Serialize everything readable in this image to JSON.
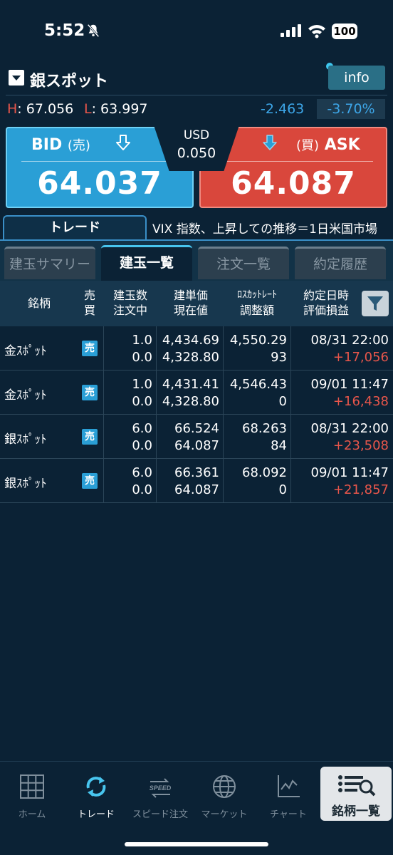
{
  "status": {
    "time": "5:52",
    "battery": "100"
  },
  "header": {
    "symbol": "銀スポット",
    "info_label": "info",
    "high_label": "H",
    "high": ": 67.056",
    "low_label": "L",
    "low": ": 63.997",
    "change": "-2.463",
    "change_pct": "-3.70%"
  },
  "quote": {
    "bid_label": "BID",
    "bid_sub": "(売)",
    "bid": "64.037",
    "ask_sub": "(買)",
    "ask_label": "ASK",
    "ask": "64.087",
    "currency": "USD",
    "spread": "0.050"
  },
  "trade_tab": "トレード",
  "ticker": "VIX 指数、上昇しての推移＝1日米国市場",
  "subtabs": [
    "建玉サマリー",
    "建玉一覧",
    "注文一覧",
    "約定履歴"
  ],
  "table_header": {
    "symbol": "銘柄",
    "side1": "売",
    "side2": "買",
    "qty1": "建玉数",
    "qty2": "注文中",
    "price1": "建単価",
    "price2": "現在値",
    "losscut1": "ﾛｽｶｯﾄﾚｰﾄ",
    "losscut2": "調整額",
    "date1": "約定日時",
    "date2": "評価損益"
  },
  "rows": [
    {
      "name": "金ｽﾎﾟｯﾄ",
      "side": "売",
      "qty": "1.0",
      "pending": "0.0",
      "entry": "4,434.69",
      "current": "4,328.80",
      "losscut": "4,550.29",
      "adjust": "93",
      "datetime": "08/31 22:00",
      "pl": "+17,056"
    },
    {
      "name": "金ｽﾎﾟｯﾄ",
      "side": "売",
      "qty": "1.0",
      "pending": "0.0",
      "entry": "4,431.41",
      "current": "4,328.80",
      "losscut": "4,546.43",
      "adjust": "0",
      "datetime": "09/01 11:47",
      "pl": "+16,438"
    },
    {
      "name": "銀ｽﾎﾟｯﾄ",
      "side": "売",
      "qty": "6.0",
      "pending": "0.0",
      "entry": "66.524",
      "current": "64.087",
      "losscut": "68.263",
      "adjust": "84",
      "datetime": "08/31 22:00",
      "pl": "+23,508"
    },
    {
      "name": "銀ｽﾎﾟｯﾄ",
      "side": "売",
      "qty": "6.0",
      "pending": "0.0",
      "entry": "66.361",
      "current": "64.087",
      "losscut": "68.092",
      "adjust": "0",
      "datetime": "09/01 11:47",
      "pl": "+21,857"
    }
  ],
  "nav": {
    "home": "ホーム",
    "trade": "トレード",
    "speed": "スピード注文",
    "market": "マーケット",
    "chart": "チャート",
    "positions": "銘柄一覧",
    "speed_icon_text": "SPEED"
  },
  "colors": {
    "bg": "#0b2235",
    "bid": "#2a9fd6",
    "ask": "#d9473c",
    "profit": "#e8564b",
    "change": "#3da6e8"
  }
}
